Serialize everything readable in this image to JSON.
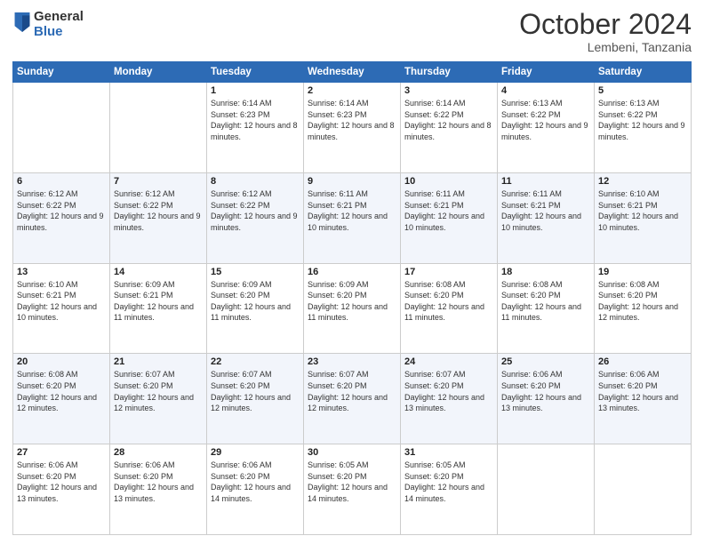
{
  "logo": {
    "general": "General",
    "blue": "Blue"
  },
  "header": {
    "month": "October 2024",
    "location": "Lembeni, Tanzania"
  },
  "days_of_week": [
    "Sunday",
    "Monday",
    "Tuesday",
    "Wednesday",
    "Thursday",
    "Friday",
    "Saturday"
  ],
  "weeks": [
    [
      {
        "day": "",
        "info": ""
      },
      {
        "day": "",
        "info": ""
      },
      {
        "day": "1",
        "info": "Sunrise: 6:14 AM\nSunset: 6:23 PM\nDaylight: 12 hours and 8 minutes."
      },
      {
        "day": "2",
        "info": "Sunrise: 6:14 AM\nSunset: 6:23 PM\nDaylight: 12 hours and 8 minutes."
      },
      {
        "day": "3",
        "info": "Sunrise: 6:14 AM\nSunset: 6:22 PM\nDaylight: 12 hours and 8 minutes."
      },
      {
        "day": "4",
        "info": "Sunrise: 6:13 AM\nSunset: 6:22 PM\nDaylight: 12 hours and 9 minutes."
      },
      {
        "day": "5",
        "info": "Sunrise: 6:13 AM\nSunset: 6:22 PM\nDaylight: 12 hours and 9 minutes."
      }
    ],
    [
      {
        "day": "6",
        "info": "Sunrise: 6:12 AM\nSunset: 6:22 PM\nDaylight: 12 hours and 9 minutes."
      },
      {
        "day": "7",
        "info": "Sunrise: 6:12 AM\nSunset: 6:22 PM\nDaylight: 12 hours and 9 minutes."
      },
      {
        "day": "8",
        "info": "Sunrise: 6:12 AM\nSunset: 6:22 PM\nDaylight: 12 hours and 9 minutes."
      },
      {
        "day": "9",
        "info": "Sunrise: 6:11 AM\nSunset: 6:21 PM\nDaylight: 12 hours and 10 minutes."
      },
      {
        "day": "10",
        "info": "Sunrise: 6:11 AM\nSunset: 6:21 PM\nDaylight: 12 hours and 10 minutes."
      },
      {
        "day": "11",
        "info": "Sunrise: 6:11 AM\nSunset: 6:21 PM\nDaylight: 12 hours and 10 minutes."
      },
      {
        "day": "12",
        "info": "Sunrise: 6:10 AM\nSunset: 6:21 PM\nDaylight: 12 hours and 10 minutes."
      }
    ],
    [
      {
        "day": "13",
        "info": "Sunrise: 6:10 AM\nSunset: 6:21 PM\nDaylight: 12 hours and 10 minutes."
      },
      {
        "day": "14",
        "info": "Sunrise: 6:09 AM\nSunset: 6:21 PM\nDaylight: 12 hours and 11 minutes."
      },
      {
        "day": "15",
        "info": "Sunrise: 6:09 AM\nSunset: 6:20 PM\nDaylight: 12 hours and 11 minutes."
      },
      {
        "day": "16",
        "info": "Sunrise: 6:09 AM\nSunset: 6:20 PM\nDaylight: 12 hours and 11 minutes."
      },
      {
        "day": "17",
        "info": "Sunrise: 6:08 AM\nSunset: 6:20 PM\nDaylight: 12 hours and 11 minutes."
      },
      {
        "day": "18",
        "info": "Sunrise: 6:08 AM\nSunset: 6:20 PM\nDaylight: 12 hours and 11 minutes."
      },
      {
        "day": "19",
        "info": "Sunrise: 6:08 AM\nSunset: 6:20 PM\nDaylight: 12 hours and 12 minutes."
      }
    ],
    [
      {
        "day": "20",
        "info": "Sunrise: 6:08 AM\nSunset: 6:20 PM\nDaylight: 12 hours and 12 minutes."
      },
      {
        "day": "21",
        "info": "Sunrise: 6:07 AM\nSunset: 6:20 PM\nDaylight: 12 hours and 12 minutes."
      },
      {
        "day": "22",
        "info": "Sunrise: 6:07 AM\nSunset: 6:20 PM\nDaylight: 12 hours and 12 minutes."
      },
      {
        "day": "23",
        "info": "Sunrise: 6:07 AM\nSunset: 6:20 PM\nDaylight: 12 hours and 12 minutes."
      },
      {
        "day": "24",
        "info": "Sunrise: 6:07 AM\nSunset: 6:20 PM\nDaylight: 12 hours and 13 minutes."
      },
      {
        "day": "25",
        "info": "Sunrise: 6:06 AM\nSunset: 6:20 PM\nDaylight: 12 hours and 13 minutes."
      },
      {
        "day": "26",
        "info": "Sunrise: 6:06 AM\nSunset: 6:20 PM\nDaylight: 12 hours and 13 minutes."
      }
    ],
    [
      {
        "day": "27",
        "info": "Sunrise: 6:06 AM\nSunset: 6:20 PM\nDaylight: 12 hours and 13 minutes."
      },
      {
        "day": "28",
        "info": "Sunrise: 6:06 AM\nSunset: 6:20 PM\nDaylight: 12 hours and 13 minutes."
      },
      {
        "day": "29",
        "info": "Sunrise: 6:06 AM\nSunset: 6:20 PM\nDaylight: 12 hours and 14 minutes."
      },
      {
        "day": "30",
        "info": "Sunrise: 6:05 AM\nSunset: 6:20 PM\nDaylight: 12 hours and 14 minutes."
      },
      {
        "day": "31",
        "info": "Sunrise: 6:05 AM\nSunset: 6:20 PM\nDaylight: 12 hours and 14 minutes."
      },
      {
        "day": "",
        "info": ""
      },
      {
        "day": "",
        "info": ""
      }
    ]
  ]
}
